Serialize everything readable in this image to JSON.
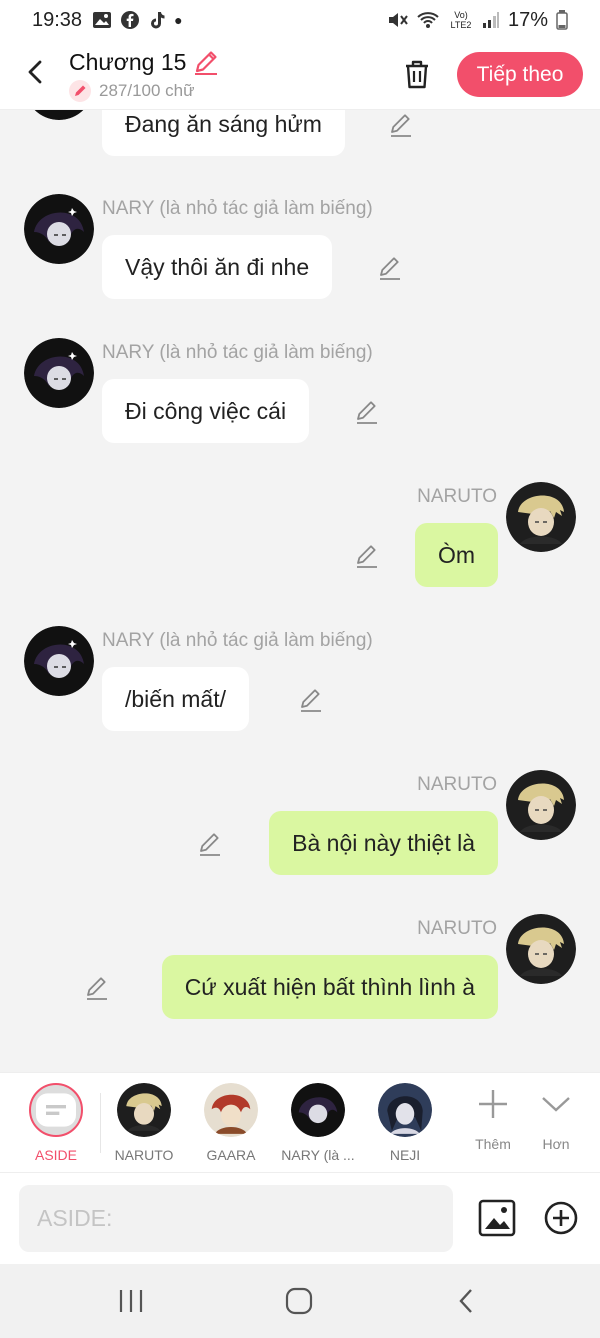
{
  "status": {
    "time": "19:38",
    "battery": "17%",
    "network": "Vo) LTE2"
  },
  "header": {
    "title": "Chương 15",
    "word_count": "287/100 chữ",
    "next_label": "Tiếp theo"
  },
  "messages": [
    {
      "side": "left",
      "name": "",
      "text": "Đang ăn sáng hửm"
    },
    {
      "side": "left",
      "name": "NARY (là nhỏ tác giả làm biếng)",
      "text": "Vậy thôi ăn đi nhe"
    },
    {
      "side": "left",
      "name": "NARY (là nhỏ tác giả làm biếng)",
      "text": "Đi công việc cái"
    },
    {
      "side": "right",
      "name": "NARUTO",
      "text": "Òm"
    },
    {
      "side": "left",
      "name": "NARY (là nhỏ tác giả làm biếng)",
      "text": "/biến mất/"
    },
    {
      "side": "right",
      "name": "NARUTO",
      "text": "Bà nội này thiệt là"
    },
    {
      "side": "right",
      "name": "NARUTO",
      "text": "Cứ xuất hiện bất thình lình à"
    }
  ],
  "characters": [
    {
      "label": "ASIDE"
    },
    {
      "label": "NARUTO"
    },
    {
      "label": "GAARA"
    },
    {
      "label": "NARY (là ..."
    },
    {
      "label": "NEJI"
    }
  ],
  "tools": {
    "add_label": "Thêm",
    "more_label": "Hơn"
  },
  "composer": {
    "placeholder": "ASIDE:"
  },
  "colors": {
    "accent": "#f24f6b",
    "right_bubble": "#daf7a1",
    "left_bubble": "#ffffff",
    "background": "#f3f3f3"
  }
}
